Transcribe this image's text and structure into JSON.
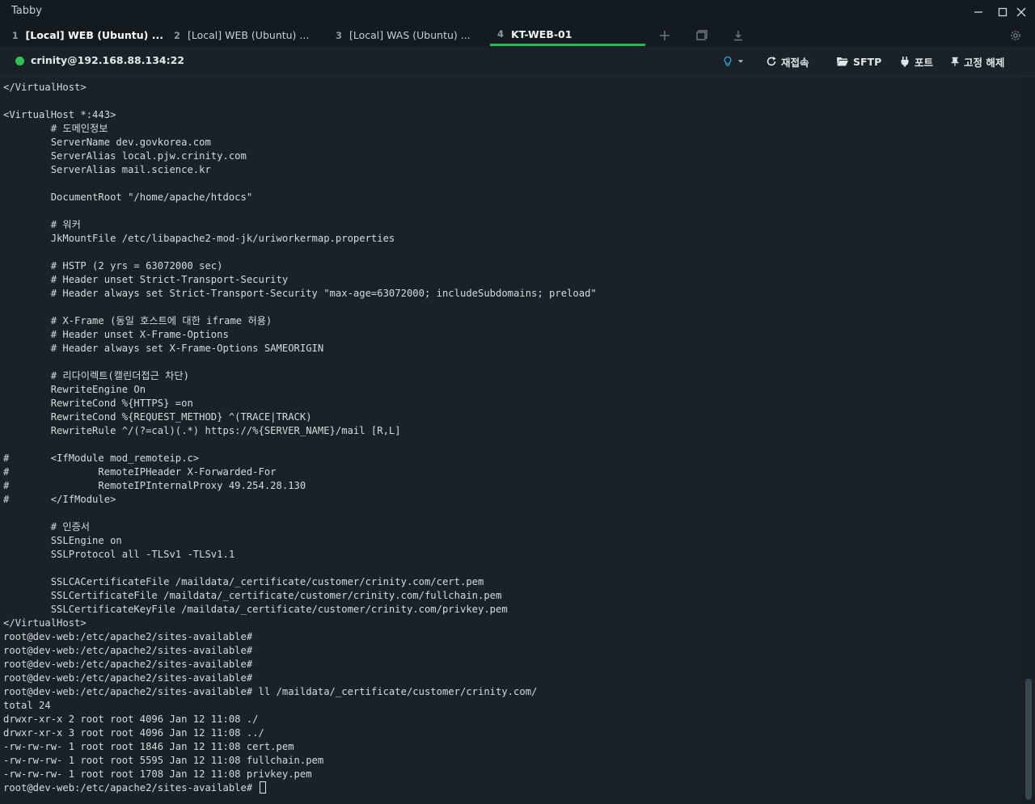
{
  "window": {
    "title": "Tabby"
  },
  "tabs": [
    {
      "num": "1",
      "label": "[Local] WEB (Ubuntu) ..."
    },
    {
      "num": "2",
      "label": "[Local] WEB (Ubuntu) ..."
    },
    {
      "num": "3",
      "label": "[Local] WAS (Ubuntu) ..."
    },
    {
      "num": "4",
      "label": "KT-WEB-01"
    }
  ],
  "toolbar": {
    "connection": "crinity@192.168.88.134:22",
    "reconnect": "재접속",
    "sftp": "SFTP",
    "ports": "포트",
    "unpin": "고정 해제"
  },
  "colors": {
    "status_connected": "#2ec454",
    "active_tab_underline": "#27b84f",
    "background": "#1a2228"
  },
  "terminal": {
    "lines": [
      "</VirtualHost>",
      "",
      "<VirtualHost *:443>",
      "        # 도메인정보",
      "        ServerName dev.govkorea.com",
      "        ServerAlias local.pjw.crinity.com",
      "        ServerAlias mail.science.kr",
      "",
      "        DocumentRoot \"/home/apache/htdocs\"",
      "",
      "        # 워커",
      "        JkMountFile /etc/libapache2-mod-jk/uriworkermap.properties",
      "",
      "        # HSTP (2 yrs = 63072000 sec)",
      "        # Header unset Strict-Transport-Security",
      "        # Header always set Strict-Transport-Security \"max-age=63072000; includeSubdomains; preload\"",
      "",
      "        # X-Frame (동일 호스트에 대한 iframe 허용)",
      "        # Header unset X-Frame-Options",
      "        # Header always set X-Frame-Options SAMEORIGIN",
      "",
      "        # 리다이렉트(캘린더접근 차단)",
      "        RewriteEngine On",
      "        RewriteCond %{HTTPS} =on",
      "        RewriteCond %{REQUEST_METHOD} ^(TRACE|TRACK)",
      "        RewriteRule ^/(?=cal)(.*) https://%{SERVER_NAME}/mail [R,L]",
      "",
      "#       <IfModule mod_remoteip.c>",
      "#               RemoteIPHeader X-Forwarded-For",
      "#               RemoteIPInternalProxy 49.254.28.130",
      "#       </IfModule>",
      "",
      "        # 인증서",
      "        SSLEngine on",
      "        SSLProtocol all -TLSv1 -TLSv1.1",
      "",
      "        SSLCACertificateFile /maildata/_certificate/customer/crinity.com/cert.pem",
      "        SSLCertificateFile /maildata/_certificate/customer/crinity.com/fullchain.pem",
      "        SSLCertificateKeyFile /maildata/_certificate/customer/crinity.com/privkey.pem",
      "</VirtualHost>",
      "root@dev-web:/etc/apache2/sites-available#",
      "root@dev-web:/etc/apache2/sites-available#",
      "root@dev-web:/etc/apache2/sites-available#",
      "root@dev-web:/etc/apache2/sites-available#",
      "root@dev-web:/etc/apache2/sites-available# ll /maildata/_certificate/customer/crinity.com/",
      "total 24",
      "drwxr-xr-x 2 root root 4096 Jan 12 11:08 ./",
      "drwxr-xr-x 3 root root 4096 Jan 12 11:08 ../",
      "-rw-rw-rw- 1 root root 1846 Jan 12 11:08 cert.pem",
      "-rw-rw-rw- 1 root root 5595 Jan 12 11:08 fullchain.pem",
      "-rw-rw-rw- 1 root root 1708 Jan 12 11:08 privkey.pem"
    ],
    "prompt": "root@dev-web:/etc/apache2/sites-available# "
  }
}
